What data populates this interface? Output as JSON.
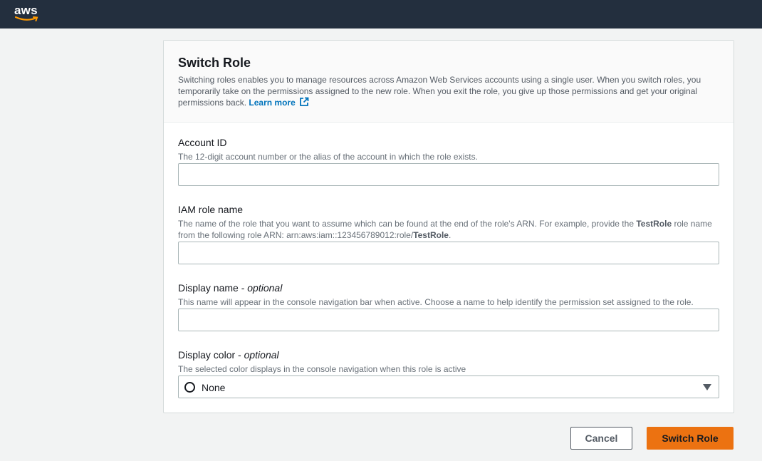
{
  "topbar": {
    "logo_text": "aws",
    "background": "#232f3e"
  },
  "panel": {
    "title": "Switch Role",
    "description": "Switching roles enables you to manage resources across Amazon Web Services accounts using a single user. When you switch roles, you temporarily take on the permissions assigned to the new role. When you exit the role, you give up those permissions and get your original permissions back.",
    "learn_more": "Learn more",
    "learn_more_icon": "external-link-icon"
  },
  "fields": {
    "account_id": {
      "label": "Account ID",
      "hint": "The 12-digit account number or the alias of the account in which the role exists.",
      "value": ""
    },
    "role_name": {
      "label": "IAM role name",
      "hint_part1": "The name of the role that you want to assume which can be found at the end of the role's ARN. For example, provide the ",
      "hint_bold1": "TestRole",
      "hint_part2": " role name from the following role ARN: arn:aws:iam::123456789012:role/",
      "hint_bold2": "TestRole",
      "hint_part3": ".",
      "value": ""
    },
    "display_name": {
      "label": "Display name - ",
      "label_optional": "optional",
      "hint": "This name will appear in the console navigation bar when active. Choose a name to help identify the permission set assigned to the role.",
      "value": ""
    },
    "display_color": {
      "label": "Display color - ",
      "label_optional": "optional",
      "hint": "The selected color displays in the console navigation when this role is active",
      "selected": "None"
    }
  },
  "actions": {
    "cancel": "Cancel",
    "submit": "Switch Role"
  },
  "colors": {
    "accent": "#ec7211",
    "link": "#0073bb"
  }
}
